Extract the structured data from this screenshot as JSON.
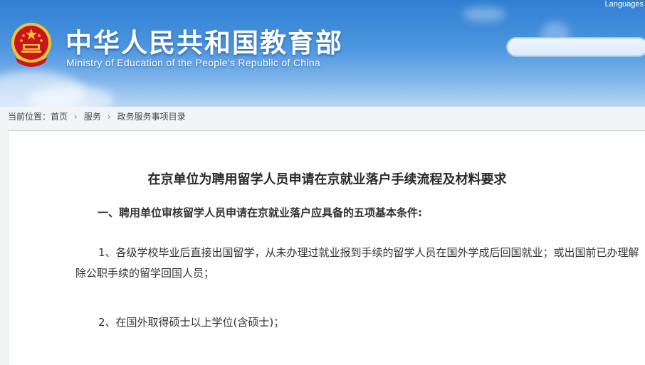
{
  "header": {
    "site_title": "中华人民共和国教育部",
    "site_subtitle": "Ministry of Education of the People's Republic of China",
    "languages_label": "Languages",
    "search_placeholder": ""
  },
  "breadcrumb": {
    "prefix": "当前位置：",
    "items": [
      "首页",
      "服务",
      "政务服务事项目录"
    ],
    "separator": "›"
  },
  "article": {
    "title": "在京单位为聘用留学人员申请在京就业落户手续流程及材料要求",
    "section_heading": "一、聘用单位审核留学人员申请在京就业落户应具备的五项基本条件:",
    "paragraphs": [
      "1、各级学校毕业后直接出国留学，从未办理过就业报到手续的留学人员在国外学成后回国就业；或出国前已办理解除公职手续的留学回国人员；",
      "2、在国外取得硕士以上学位(含硕士)；"
    ]
  },
  "colors": {
    "header_blue": "#2f7fd3",
    "emblem_red": "#c8161d",
    "emblem_gold": "#f6c431"
  }
}
